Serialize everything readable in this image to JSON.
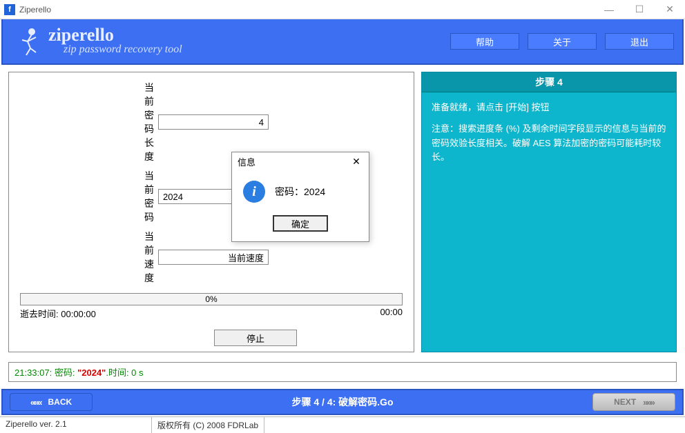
{
  "window": {
    "title": "Ziperello"
  },
  "header": {
    "brand": "ziperello",
    "tagline": "zip password recovery tool",
    "buttons": {
      "help": "帮助",
      "about": "关于",
      "exit": "退出"
    }
  },
  "form": {
    "pwd_len_label": "当前密码长度",
    "pwd_len_value": "4",
    "pwd_label": "当前密码",
    "pwd_value": "2024",
    "speed_label": "当前速度",
    "speed_value": "当前速度"
  },
  "progress": {
    "percent": "0%",
    "elapsed_label": "逝去时间:",
    "elapsed_value": "00:00:00",
    "remaining_value": "00:00"
  },
  "actions": {
    "stop": "停止"
  },
  "sidebar": {
    "title": "步骤 4",
    "line1": "准备就绪，请点击 [开始] 按钮",
    "line2": "注意：搜索进度条 (%) 及剩余时间字段显示的信息与当前的密码效验长度相关。破解 AES 算法加密的密码可能耗时较长。"
  },
  "result": {
    "time": "21:33:07:",
    "label": "密码:",
    "pwd": "\"2024\"",
    "duration": ".时间: 0 s"
  },
  "bottom": {
    "back": "BACK",
    "step": "步骤 4 / 4: 破解密码.Go",
    "next": "NEXT"
  },
  "status": {
    "version": "Ziperello ver. 2.1",
    "copyright": "版权所有 (C) 2008 FDRLab"
  },
  "modal": {
    "title": "信息",
    "msg_label": "密码：",
    "msg_value": "2024",
    "ok": "确定"
  }
}
